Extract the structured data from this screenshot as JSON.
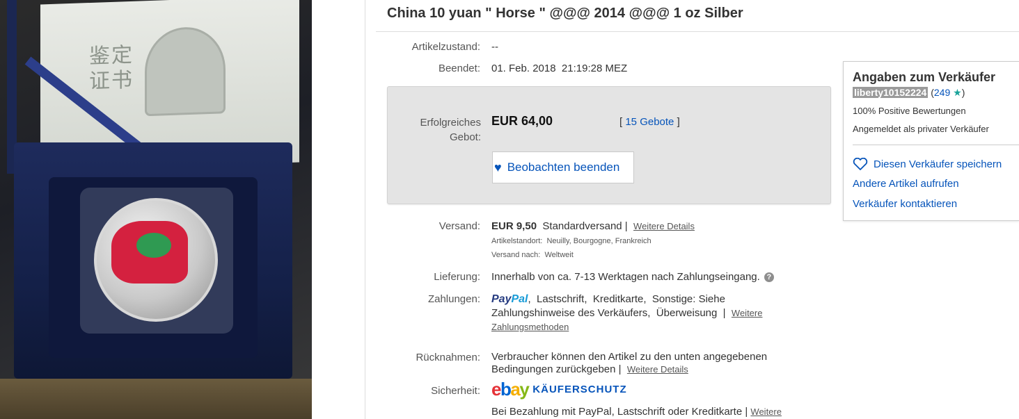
{
  "listing": {
    "title": "China 10 yuan \" Horse \" @@@ 2014 @@@ 1 oz Silber"
  },
  "details": {
    "condition_label": "Artikelzustand:",
    "condition_value": "--",
    "ended_label": "Beendet:",
    "ended_value": "01. Feb. 2018  21:19:28 MEZ"
  },
  "bid_box": {
    "label_line1": "Erfolgreiches",
    "label_line2": "Gebot:",
    "price": "EUR 64,00",
    "bids_open": "[ ",
    "bids_link": "15 Gebote",
    "bids_close": " ]",
    "watch_label": "Beobachten beenden",
    "watch_icon": "heart-icon"
  },
  "shipping": {
    "label": "Versand:",
    "price": "EUR 9,50",
    "service": "Standardversand |",
    "details_link": "Weitere Details",
    "location": "Artikelstandort:  Neuilly, Bourgogne, Frankreich",
    "ships_to": "Versand nach:  Weltweit"
  },
  "delivery": {
    "label": "Lieferung:",
    "value": "Innerhalb von ca. 7-13 Werktagen nach Zahlungseingang.",
    "help_glyph": "?"
  },
  "payments": {
    "label": "Zahlungen:",
    "paypal_part1": "Pay",
    "paypal_part2": "Pal",
    "line1_rest": ",  Lastschrift,  Kreditkarte,  Sonstige: Siehe",
    "line2": "Zahlungshinweise des Verkäufers,  Überweisung  |",
    "more_link_part1": "Weitere",
    "more_link_part2": "Zahlungsmethoden"
  },
  "returns": {
    "label": "Rücknahmen:",
    "line1": "Verbraucher können den Artikel zu den unten angegebenen",
    "line2": "Bedingungen zurückgeben |",
    "details_link": "Weitere Details"
  },
  "security": {
    "label": "Sicherheit:",
    "ebay_e": "e",
    "ebay_b": "b",
    "ebay_a": "a",
    "ebay_y": "y",
    "program": "KÄUFERSCHUTZ",
    "note": "Bei Bezahlung mit PayPal, Lastschrift oder Kreditkarte |",
    "more_link": "Weitere"
  },
  "seller": {
    "heading": "Angaben zum Verkäufer",
    "username": "liberty10152224",
    "feedback_open": " (",
    "feedback_count": "249",
    "feedback_star": "★",
    "feedback_close": ")",
    "positive": "100% Positive Bewertungen",
    "account_type": "Angemeldet als privater Verkäufer",
    "save_seller": "Diesen Verkäufer speichern",
    "other_items": "Andere Artikel aufrufen",
    "contact": "Verkäufer kontaktieren"
  },
  "colors": {
    "link_blue": "#0654ba",
    "bid_box_bg": "#e4e4e4",
    "star_teal": "#1aa39a"
  }
}
